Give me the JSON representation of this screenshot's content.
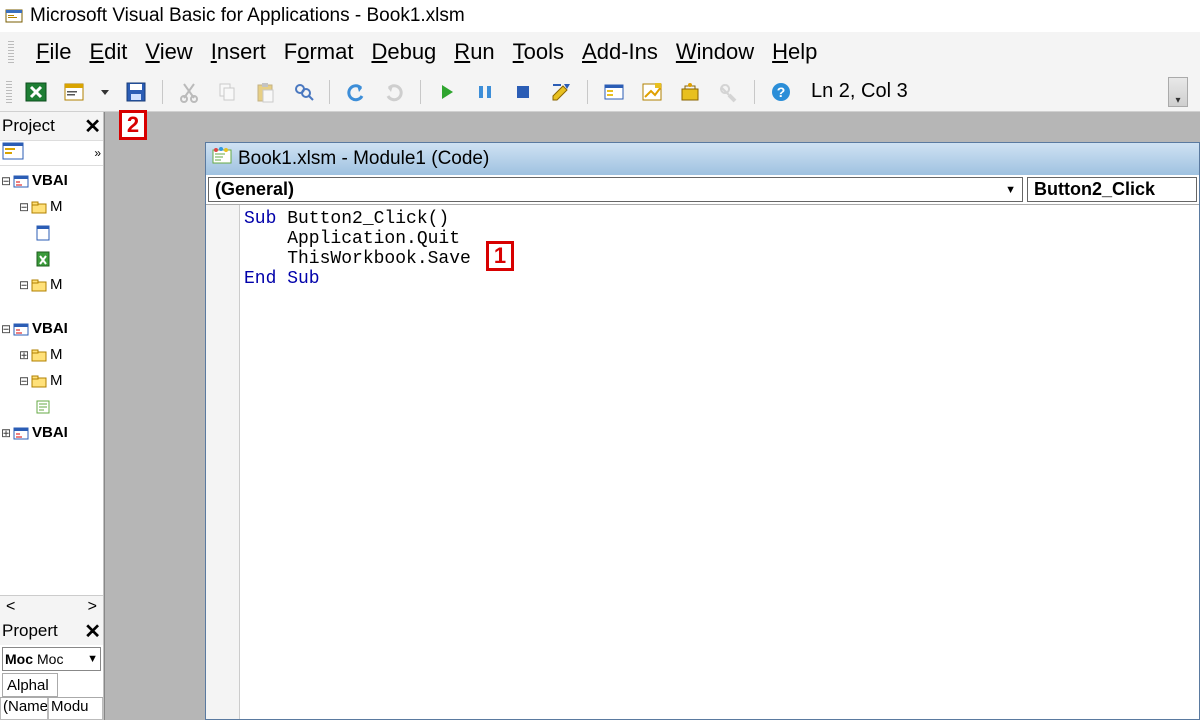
{
  "title": "Microsoft Visual Basic for Applications - Book1.xlsm",
  "menu": {
    "file": "File",
    "edit": "Edit",
    "view": "View",
    "insert": "Insert",
    "format": "Format",
    "debug": "Debug",
    "run": "Run",
    "tools": "Tools",
    "addins": "Add-Ins",
    "window": "Window",
    "help": "Help"
  },
  "toolbar": {
    "status": "Ln 2, Col 3"
  },
  "annotations": {
    "a1": "1",
    "a2": "2"
  },
  "project_pane": {
    "title": "Project",
    "nodes": {
      "p1": "VBAI",
      "p1_f1": "M",
      "p1_f1b": "M",
      "p2": "VBAI",
      "p2_f1": "M",
      "p2_f2": "M",
      "p3": "VBAI"
    },
    "scroll_left": "<",
    "scroll_right": ">"
  },
  "properties_pane": {
    "title": "Propert",
    "combo_bold": "Moc",
    "combo_rest": "Moc",
    "tab": "Alphal",
    "row1_name": "(Name",
    "row1_val": "Modu"
  },
  "code_window": {
    "title": "Book1.xlsm - Module1 (Code)",
    "dd_general": "(General)",
    "dd_proc": "Button2_Click",
    "code": {
      "l1a": "Sub",
      "l1b": " Button2_Click()",
      "l2": "    Application.Quit",
      "l3": "    ThisWorkbook.Save",
      "l4": "End Sub"
    }
  }
}
